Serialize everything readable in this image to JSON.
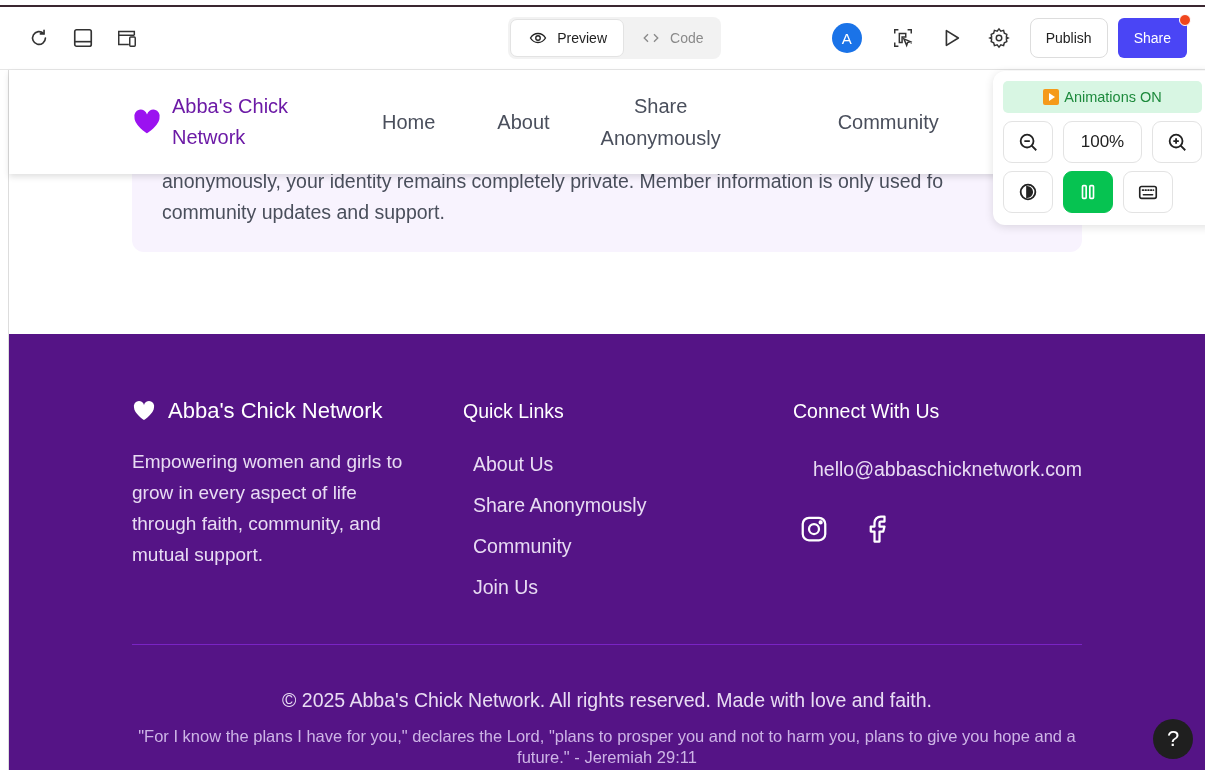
{
  "toolbar": {
    "view_tabs": [
      {
        "label": "Preview",
        "selected": true
      },
      {
        "label": "Code",
        "selected": false
      }
    ],
    "avatar": "A",
    "publish": "Publish",
    "share": "Share",
    "share_notification": true
  },
  "nav": {
    "brand": "Abba's Chick Network",
    "links": [
      "Home",
      "About",
      "Share Anonymously",
      "Community"
    ]
  },
  "privacy_card": {
    "lines": [
      "anonymously, your identity remains completely private. Member information is only used fo",
      "community updates and support."
    ]
  },
  "floating_panel": {
    "animations": "Animations ON",
    "zoom": "100%",
    "pause_active": true
  },
  "footer": {
    "brand": "Abba's Chick Network",
    "about": "Empowering women and girls to grow in every aspect of life through faith, community, and mutual support.",
    "quick_links_title": "Quick Links",
    "quick_links": [
      "About Us",
      "Share Anonymously",
      "Community",
      "Join Us"
    ],
    "connect_title": "Connect With Us",
    "email": "hello@abbaschicknetwork.com",
    "copyright": "© 2025 Abba's Chick Network. All rights reserved. Made with love and faith.",
    "verse": "\"For I know the plans I have for you,\" declares the Lord, \"plans to prosper you and not to harm you, plans to give you hope and a future.\" - Jeremiah 29:11"
  },
  "help": "?"
}
